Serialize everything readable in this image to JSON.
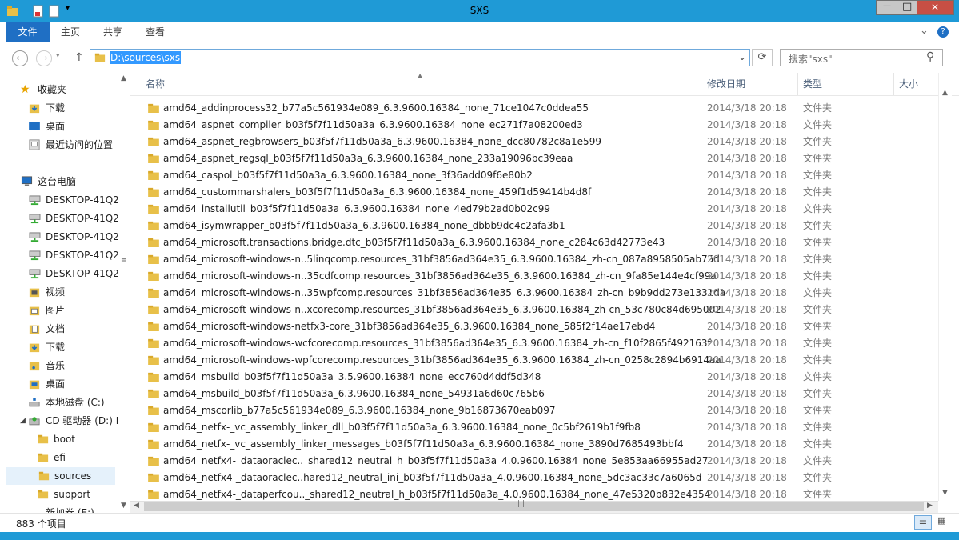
{
  "window": {
    "title": "SXS",
    "minimize_glyph": "—",
    "maximize_glyph": "□",
    "close_glyph": "✕"
  },
  "ribbon": {
    "tabs": [
      "文件",
      "主页",
      "共享",
      "查看"
    ],
    "expand_glyph": "⌄",
    "help_glyph": "?"
  },
  "address": {
    "path": "D:\\sources\\sxs",
    "dropdown_glyph": "⌄",
    "refresh_glyph": "⟳",
    "back_glyph": "←",
    "forward_glyph": "→",
    "up_glyph": "↑"
  },
  "search": {
    "placeholder": "搜索\"sxs\"",
    "icon_glyph": "⚲"
  },
  "nav": {
    "favorites_label": "收藏夹",
    "favorites": [
      "下载",
      "桌面",
      "最近访问的位置"
    ],
    "thispc_label": "这台电脑",
    "network_items": [
      "DESKTOP-41Q2",
      "DESKTOP-41Q2",
      "DESKTOP-41Q2",
      "DESKTOP-41Q2",
      "DESKTOP-41Q2"
    ],
    "libraries": [
      "视频",
      "图片",
      "文档",
      "下载",
      "音乐",
      "桌面"
    ],
    "drive_c": "本地磁盘 (C:)",
    "drive_d": "CD 驱动器 (D:) I",
    "drive_d_children": [
      "boot",
      "efi",
      "sources",
      "support"
    ],
    "selected_item": "sources",
    "partial_item": "新加卷 (E:)"
  },
  "columns": {
    "name": "名称",
    "date": "修改日期",
    "type": "类型",
    "size": "大小",
    "sort_glyph": "▲"
  },
  "files": [
    {
      "name": "amd64_addinprocess32_b77a5c561934e089_6.3.9600.16384_none_71ce1047c0ddea55",
      "date": "2014/3/18 20:18",
      "type": "文件夹"
    },
    {
      "name": "amd64_aspnet_compiler_b03f5f7f11d50a3a_6.3.9600.16384_none_ec271f7a08200ed3",
      "date": "2014/3/18 20:18",
      "type": "文件夹"
    },
    {
      "name": "amd64_aspnet_regbrowsers_b03f5f7f11d50a3a_6.3.9600.16384_none_dcc80782c8a1e599",
      "date": "2014/3/18 20:18",
      "type": "文件夹"
    },
    {
      "name": "amd64_aspnet_regsql_b03f5f7f11d50a3a_6.3.9600.16384_none_233a19096bc39eaa",
      "date": "2014/3/18 20:18",
      "type": "文件夹"
    },
    {
      "name": "amd64_caspol_b03f5f7f11d50a3a_6.3.9600.16384_none_3f36add09f6e80b2",
      "date": "2014/3/18 20:18",
      "type": "文件夹"
    },
    {
      "name": "amd64_custommarshalers_b03f5f7f11d50a3a_6.3.9600.16384_none_459f1d59414b4d8f",
      "date": "2014/3/18 20:18",
      "type": "文件夹"
    },
    {
      "name": "amd64_installutil_b03f5f7f11d50a3a_6.3.9600.16384_none_4ed79b2ad0b02c99",
      "date": "2014/3/18 20:18",
      "type": "文件夹"
    },
    {
      "name": "amd64_isymwrapper_b03f5f7f11d50a3a_6.3.9600.16384_none_dbbb9dc4c2afa3b1",
      "date": "2014/3/18 20:18",
      "type": "文件夹"
    },
    {
      "name": "amd64_microsoft.transactions.bridge.dtc_b03f5f7f11d50a3a_6.3.9600.16384_none_c284c63d42773e43",
      "date": "2014/3/18 20:18",
      "type": "文件夹"
    },
    {
      "name": "amd64_microsoft-windows-n..5linqcomp.resources_31bf3856ad364e35_6.3.9600.16384_zh-cn_087a8958505ab75d",
      "date": "2014/3/18 20:18",
      "type": "文件夹"
    },
    {
      "name": "amd64_microsoft-windows-n..35cdfcomp.resources_31bf3856ad364e35_6.3.9600.16384_zh-cn_9fa85e144e4cf99a",
      "date": "2014/3/18 20:18",
      "type": "文件夹"
    },
    {
      "name": "amd64_microsoft-windows-n..35wpfcomp.resources_31bf3856ad364e35_6.3.9600.16384_zh-cn_b9b9dd273e1331da",
      "date": "2014/3/18 20:18",
      "type": "文件夹"
    },
    {
      "name": "amd64_microsoft-windows-n..xcorecomp.resources_31bf3856ad364e35_6.3.9600.16384_zh-cn_53c780c84d695002",
      "date": "2014/3/18 20:18",
      "type": "文件夹"
    },
    {
      "name": "amd64_microsoft-windows-netfx3-core_31bf3856ad364e35_6.3.9600.16384_none_585f2f14ae17ebd4",
      "date": "2014/3/18 20:18",
      "type": "文件夹"
    },
    {
      "name": "amd64_microsoft-windows-wcfcorecomp.resources_31bf3856ad364e35_6.3.9600.16384_zh-cn_f10f2865f492163f",
      "date": "2014/3/18 20:18",
      "type": "文件夹"
    },
    {
      "name": "amd64_microsoft-windows-wpfcorecomp.resources_31bf3856ad364e35_6.3.9600.16384_zh-cn_0258c2894b6914aa",
      "date": "2014/3/18 20:18",
      "type": "文件夹"
    },
    {
      "name": "amd64_msbuild_b03f5f7f11d50a3a_3.5.9600.16384_none_ecc760d4ddf5d348",
      "date": "2014/3/18 20:18",
      "type": "文件夹"
    },
    {
      "name": "amd64_msbuild_b03f5f7f11d50a3a_6.3.9600.16384_none_54931a6d60c765b6",
      "date": "2014/3/18 20:18",
      "type": "文件夹"
    },
    {
      "name": "amd64_mscorlib_b77a5c561934e089_6.3.9600.16384_none_9b16873670eab097",
      "date": "2014/3/18 20:18",
      "type": "文件夹"
    },
    {
      "name": "amd64_netfx-_vc_assembly_linker_dll_b03f5f7f11d50a3a_6.3.9600.16384_none_0c5bf2619b1f9fb8",
      "date": "2014/3/18 20:18",
      "type": "文件夹"
    },
    {
      "name": "amd64_netfx-_vc_assembly_linker_messages_b03f5f7f11d50a3a_6.3.9600.16384_none_3890d7685493bbf4",
      "date": "2014/3/18 20:18",
      "type": "文件夹"
    },
    {
      "name": "amd64_netfx4-_dataoraclec.._shared12_neutral_h_b03f5f7f11d50a3a_4.0.9600.16384_none_5e853aa66955ad27",
      "date": "2014/3/18 20:18",
      "type": "文件夹"
    },
    {
      "name": "amd64_netfx4-_dataoraclec..hared12_neutral_ini_b03f5f7f11d50a3a_4.0.9600.16384_none_5dc3ac33c7a6065d",
      "date": "2014/3/18 20:18",
      "type": "文件夹"
    },
    {
      "name": "amd64_netfx4-_dataperfcou.._shared12_neutral_h_b03f5f7f11d50a3a_4.0.9600.16384_none_47e5320b832e4354",
      "date": "2014/3/18 20:18",
      "type": "文件夹"
    }
  ],
  "status": {
    "item_count": "883 个项目"
  },
  "colors": {
    "titlebar": "#1f9ad6",
    "file_tab": "#1f6fc4",
    "selection": "#3399ff",
    "folder": "#e8c049",
    "close_button": "#c74f44"
  }
}
